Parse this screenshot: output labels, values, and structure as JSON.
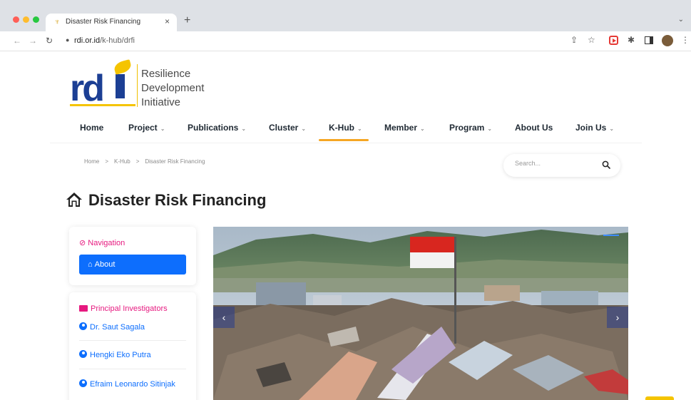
{
  "browser": {
    "tab_title": "Disaster Risk Financing",
    "tab_close": "×",
    "new_tab": "+",
    "tab_menu": "⌄",
    "back": "←",
    "forward": "→",
    "reload": "↻",
    "lock": "🔒",
    "url_host": "rdi.or.id",
    "url_path": "/k-hub/drfi",
    "icons": [
      "share-icon",
      "star-icon",
      "record-extension-icon",
      "puzzle-extension-icon",
      "side-panel-icon",
      "profile-avatar",
      "more-menu-icon"
    ]
  },
  "logo": {
    "mark": "rd",
    "line1": "Resilience",
    "line2": "Development",
    "line3": "Initiative"
  },
  "nav": {
    "items": [
      {
        "label": "Home",
        "has_dropdown": false
      },
      {
        "label": "Project",
        "has_dropdown": true
      },
      {
        "label": "Publications",
        "has_dropdown": true
      },
      {
        "label": "Cluster",
        "has_dropdown": true
      },
      {
        "label": "K-Hub",
        "has_dropdown": true,
        "active": true
      },
      {
        "label": "Member",
        "has_dropdown": true
      },
      {
        "label": "Program",
        "has_dropdown": true
      },
      {
        "label": "About Us",
        "has_dropdown": false
      },
      {
        "label": "Join Us",
        "has_dropdown": true
      }
    ],
    "chevron": "⌄",
    "accent": "#f5a623"
  },
  "breadcrumb": {
    "items": [
      "Home",
      "K-Hub",
      "Disaster Risk Financing"
    ],
    "separator": ">"
  },
  "search": {
    "placeholder": "Search..."
  },
  "page": {
    "title": "Disaster Risk Financing"
  },
  "sidebar": {
    "navigation_heading": "Navigation",
    "navigation_icon": "⊘",
    "about_button": "About",
    "about_icon": "⌂",
    "pi_heading": "Principal Investigators",
    "investigators": [
      "Dr. Saut Sagala",
      "Hengki Eko Putra",
      "Efraim Leonardo Sitinjak"
    ]
  },
  "slider": {
    "prev": "‹",
    "next": "›"
  },
  "colors": {
    "brand_blue": "#1c3f94",
    "brand_yellow": "#f5c400",
    "link_blue": "#0d6efd",
    "heading_pink": "#e6197f"
  }
}
